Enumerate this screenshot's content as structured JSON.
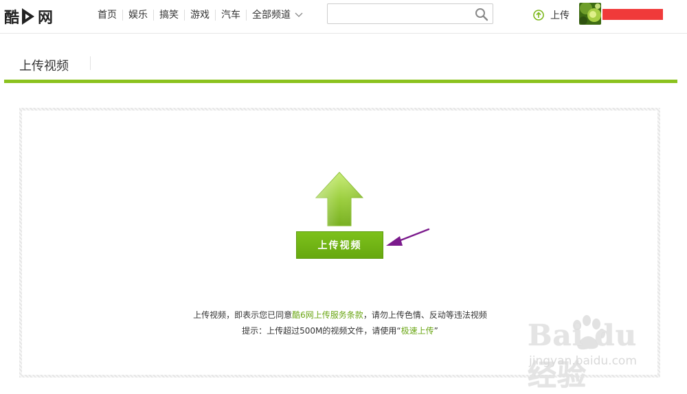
{
  "header": {
    "logo_left": "酷",
    "logo_right": "网",
    "nav": [
      {
        "label": "首页"
      },
      {
        "label": "娱乐"
      },
      {
        "label": "搞笑"
      },
      {
        "label": "游戏"
      },
      {
        "label": "汽车"
      },
      {
        "label": "全部频道"
      }
    ],
    "search": {
      "value": "",
      "placeholder": ""
    },
    "upload_label": "上传"
  },
  "page": {
    "title": "上传视频",
    "upload_button_label": "上传视频",
    "notice_line1": {
      "before": "上传视频，即表示您已同意",
      "link": "酷6网上传服务条款",
      "after": "，请勿上传色情、反动等违法视频"
    },
    "notice_line2": {
      "before": "提示：上传超过500M的视频文件，请使用“",
      "link": "极速上传",
      "after": "”"
    }
  },
  "watermark": {
    "main": "Bai du 经验",
    "sub": "jingyan.baidu.com"
  },
  "colors": {
    "accent_green": "#8bc21e",
    "button_green": "#6fb316",
    "link_green": "#6aa614",
    "annotation_purple": "#7b1a8c",
    "redaction_red": "#f03a3a"
  }
}
